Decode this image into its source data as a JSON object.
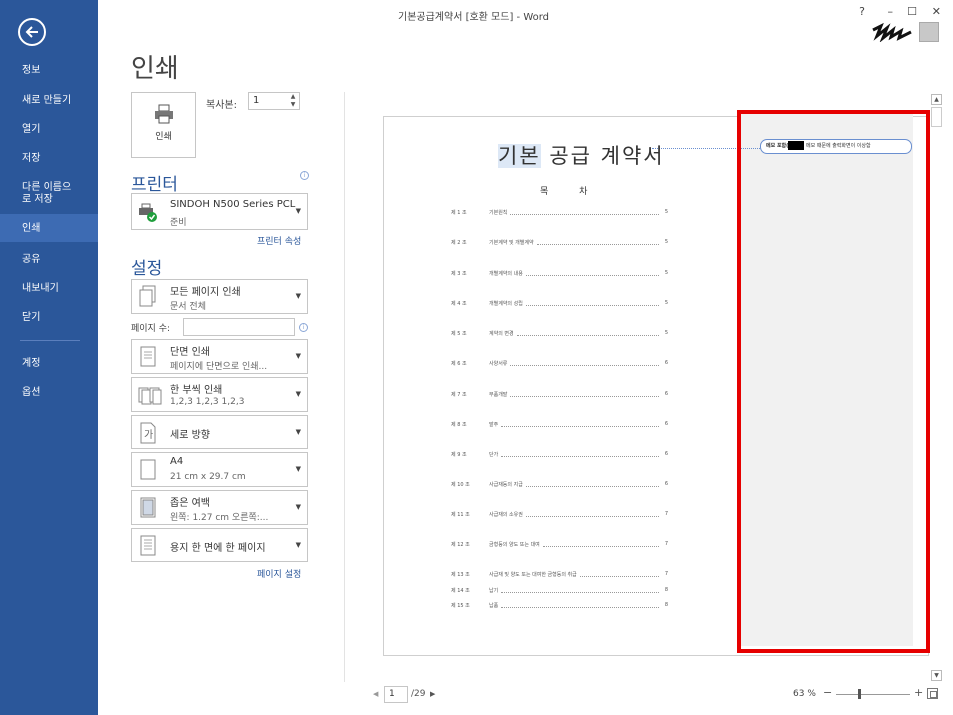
{
  "titlebar": {
    "title": "기본공급계약서 [호환 모드] - Word",
    "help": "?",
    "minimize": "–",
    "restore": "☐",
    "close": "✕"
  },
  "nav": {
    "items": [
      {
        "label": "정보"
      },
      {
        "label": "새로 만들기"
      },
      {
        "label": "열기"
      },
      {
        "label": "저장"
      },
      {
        "label": "다른 이름으로 저장"
      },
      {
        "label": "인쇄"
      },
      {
        "label": "공유"
      },
      {
        "label": "내보내기"
      },
      {
        "label": "닫기"
      },
      {
        "label": "계정"
      },
      {
        "label": "옵션"
      }
    ]
  },
  "print": {
    "heading": "인쇄",
    "print_button_label": "인쇄",
    "copies_label": "복사본:",
    "copies_value": "1",
    "printer_section": "프린터",
    "printer_name": "SINDOH N500 Series PCL",
    "printer_status": "준비",
    "printer_properties": "프린터 속성",
    "settings_section": "설정",
    "settings": [
      {
        "line1": "모든 페이지 인쇄",
        "line2": "문서 전체"
      },
      {
        "line1": "단면 인쇄",
        "line2": "페이지에 단면으로 인쇄..."
      },
      {
        "line1": "한 부씩 인쇄",
        "line2": "1,2,3    1,2,3    1,2,3"
      },
      {
        "line1": "세로 방향",
        "line2": ""
      },
      {
        "line1": "A4",
        "line2": "21 cm x 29.7 cm"
      },
      {
        "line1": "좁은 여백",
        "line2": "왼쪽:  1.27 cm    오른쪽:..."
      },
      {
        "line1": "용지 한 면에 한 페이지",
        "line2": ""
      }
    ],
    "pages_label": "페이지 수:",
    "pages_value": "",
    "page_setup": "페이지 설정"
  },
  "preview": {
    "doc_title_highlight": "기본",
    "doc_title_rest": " 공급 계약서",
    "toc_heading": "목 차",
    "comment_prefix": "메모 포함(",
    "comment_suffix": "메모 때문에 출력화면이 이상함",
    "toc": [
      {
        "num": "제 1 조",
        "text": "기본원칙",
        "page": "5"
      },
      {
        "num": "제 2 조",
        "text": "기본계약 및 개별계약",
        "page": "5"
      },
      {
        "num": "제 3 조",
        "text": "개별계약의 내용",
        "page": "5"
      },
      {
        "num": "제 4 조",
        "text": "개별계약의 성립",
        "page": "5"
      },
      {
        "num": "제 5 조",
        "text": "계약의 변경",
        "page": "5"
      },
      {
        "num": "제 6 조",
        "text": "사양서류",
        "page": "6"
      },
      {
        "num": "제 7 조",
        "text": "부품개발",
        "page": "6"
      },
      {
        "num": "제 8 조",
        "text": "발주",
        "page": "6"
      },
      {
        "num": "제 9 조",
        "text": "단가",
        "page": "6"
      },
      {
        "num": "제 10 조",
        "text": "사급재등의 지급",
        "page": "6"
      },
      {
        "num": "제 11 조",
        "text": "사급재의 소유권",
        "page": "7"
      },
      {
        "num": "제 12 조",
        "text": "금형등의 양도 또는 대여",
        "page": "7"
      },
      {
        "num": "제 13 조",
        "text": "사급재 및 양도 또는 대여한 금형등의 취급",
        "page": "7"
      },
      {
        "num": "제 14 조",
        "text": "납기",
        "page": "8"
      },
      {
        "num": "제 15 조",
        "text": "납품",
        "page": "8"
      }
    ]
  },
  "bottom": {
    "page_current": "1",
    "page_total": "/29",
    "zoom": "63 %",
    "zoom_minus": "−",
    "zoom_plus": "+"
  },
  "colors": {
    "nav_bg": "#2b579a",
    "accent": "#2b579a",
    "highlight_box": "#e60000"
  }
}
